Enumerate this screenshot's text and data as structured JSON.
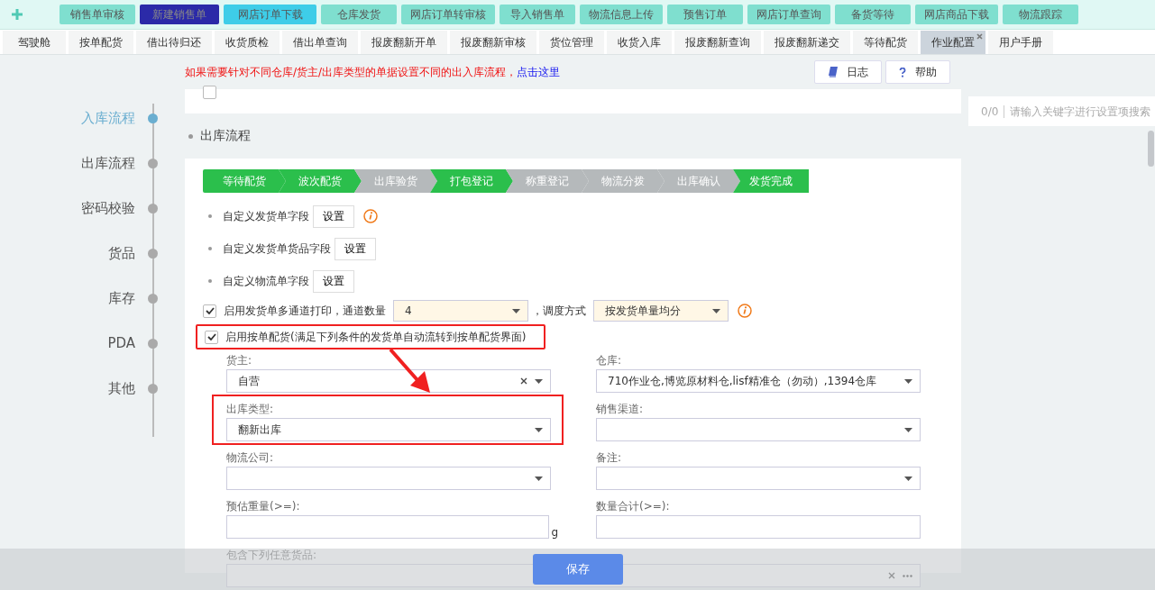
{
  "top_nav": [
    {
      "label": "销售单审核",
      "kind": "normal"
    },
    {
      "label": "新建销售单",
      "kind": "current"
    },
    {
      "label": "网店订单下载",
      "kind": "hover"
    },
    {
      "label": "仓库发货",
      "kind": "normal"
    },
    {
      "label": "网店订单转审核",
      "kind": "normal"
    },
    {
      "label": "导入销售单",
      "kind": "normal"
    },
    {
      "label": "物流信息上传",
      "kind": "normal"
    },
    {
      "label": "预售订单",
      "kind": "normal"
    },
    {
      "label": "网店订单查询",
      "kind": "normal"
    },
    {
      "label": "备货等待",
      "kind": "normal"
    },
    {
      "label": "网店商品下载",
      "kind": "normal"
    },
    {
      "label": "物流跟踪",
      "kind": "normal"
    }
  ],
  "tabs": [
    {
      "label": "驾驶舱",
      "selected": false
    },
    {
      "label": "按单配货",
      "selected": false
    },
    {
      "label": "借出待归还",
      "selected": false
    },
    {
      "label": "收货质检",
      "selected": false
    },
    {
      "label": "借出单查询",
      "selected": false
    },
    {
      "label": "报废翻新开单",
      "selected": false
    },
    {
      "label": "报废翻新审核",
      "selected": false
    },
    {
      "label": "货位管理",
      "selected": false
    },
    {
      "label": "收货入库",
      "selected": false
    },
    {
      "label": "报废翻新查询",
      "selected": false
    },
    {
      "label": "报废翻新递交",
      "selected": false
    },
    {
      "label": "等待配货",
      "selected": false
    },
    {
      "label": "作业配置",
      "selected": true
    },
    {
      "label": "用户手册",
      "selected": false
    }
  ],
  "sidebar": {
    "items": [
      {
        "label": "入库流程",
        "selected": true
      },
      {
        "label": "出库流程",
        "selected": false
      },
      {
        "label": "密码校验",
        "selected": false
      },
      {
        "label": "货品",
        "selected": false
      },
      {
        "label": "库存",
        "selected": false
      },
      {
        "label": "PDA",
        "selected": false
      },
      {
        "label": "其他",
        "selected": false
      }
    ]
  },
  "notice": {
    "text": "如果需要针对不同仓库/货主/出库类型的单据设置不同的出入库流程，",
    "link": "点击这里"
  },
  "toolbar": [
    {
      "label": "日志",
      "kind": "log"
    },
    {
      "label": "帮助",
      "kind": "help"
    }
  ],
  "search": {
    "counter": "0/0",
    "placeholder": "请输入关键字进行设置项搜索"
  },
  "previous_card": {
    "checked": false
  },
  "section": {
    "title": "出库流程",
    "steps": [
      {
        "label": "等待配货",
        "active": true
      },
      {
        "label": "波次配货",
        "active": true
      },
      {
        "label": "出库验货",
        "active": false
      },
      {
        "label": "打包登记",
        "active": true
      },
      {
        "label": "称重登记",
        "active": false
      },
      {
        "label": "物流分拨",
        "active": false
      },
      {
        "label": "出库确认",
        "active": false
      },
      {
        "label": "发货完成",
        "active": true
      }
    ],
    "field_settings": [
      {
        "label": "自定义发货单字段",
        "button": "设置",
        "info": true
      },
      {
        "label": "自定义发货单货品字段",
        "button": "设置",
        "info": false
      },
      {
        "label": "自定义物流单字段",
        "button": "设置",
        "info": false
      }
    ],
    "multichannel": {
      "checked": true,
      "label": "启用发货单多通道打印，通道数量",
      "channels": "4",
      "separator": "，调度方式",
      "mode": "按发货单量均分"
    },
    "allocation": {
      "checked": true,
      "label": "启用按单配货(满足下列条件的发货单自动流转到按单配货界面)",
      "highlighted": true
    },
    "filters": [
      {
        "label": "货主:",
        "kind": "select",
        "value": "自营",
        "clearable": true,
        "highlighted": false
      },
      {
        "label": "仓库:",
        "kind": "select",
        "value": "710作业仓,博览原材料仓,lisf精准仓（勿动）,1394仓库",
        "clearable": false,
        "highlighted": false
      },
      {
        "label": "出库类型:",
        "kind": "select",
        "value": "翻新出库",
        "clearable": false,
        "highlighted": true
      },
      {
        "label": "销售渠道:",
        "kind": "select",
        "clearable": false,
        "highlighted": false
      },
      {
        "label": "物流公司:",
        "kind": "select",
        "clearable": false,
        "highlighted": false
      },
      {
        "label": "备注:",
        "kind": "select",
        "clearable": false,
        "highlighted": false
      },
      {
        "label": "预估重量(>=):",
        "kind": "text",
        "unit": "g",
        "highlighted": false
      },
      {
        "label": "数量合计(>=):",
        "kind": "text",
        "highlighted": false
      },
      {
        "label": "包含下列任意货品:",
        "kind": "picker",
        "highlighted": false
      }
    ]
  },
  "save_button": "保存"
}
